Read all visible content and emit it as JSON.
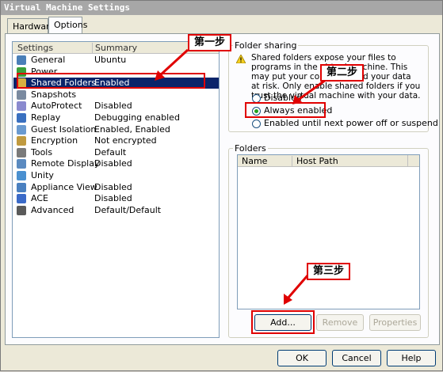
{
  "window": {
    "title": "Virtual Machine Settings"
  },
  "tabs": [
    {
      "label": "Hardware"
    },
    {
      "label": "Options"
    }
  ],
  "settings_list": {
    "col_settings": "Settings",
    "col_summary": "Summary",
    "items": [
      {
        "name": "General",
        "summary": "Ubuntu",
        "icon": "general-icon",
        "color": "#4a7fb8"
      },
      {
        "name": "Power",
        "summary": "",
        "icon": "power-icon",
        "color": "#3aa03a"
      },
      {
        "name": "Shared Folders",
        "summary": "Enabled",
        "icon": "shared-folders-icon",
        "color": "#d8b040"
      },
      {
        "name": "Snapshots",
        "summary": "",
        "icon": "snapshots-icon",
        "color": "#7a8aa0"
      },
      {
        "name": "AutoProtect",
        "summary": "Disabled",
        "icon": "autoprotect-icon",
        "color": "#8a8acf"
      },
      {
        "name": "Replay",
        "summary": "Debugging enabled",
        "icon": "replay-icon",
        "color": "#3a70c0"
      },
      {
        "name": "Guest Isolation",
        "summary": "Enabled, Enabled",
        "icon": "guest-isolation-icon",
        "color": "#6a9ad0"
      },
      {
        "name": "Encryption",
        "summary": "Not encrypted",
        "icon": "encryption-icon",
        "color": "#c09a40"
      },
      {
        "name": "Tools",
        "summary": "Default",
        "icon": "tools-icon",
        "color": "#7a7a7a"
      },
      {
        "name": "Remote Display",
        "summary": "Disabled",
        "icon": "remote-display-icon",
        "color": "#5a8ac0"
      },
      {
        "name": "Unity",
        "summary": "",
        "icon": "unity-icon",
        "color": "#4a90d0"
      },
      {
        "name": "Appliance View",
        "summary": "Disabled",
        "icon": "appliance-view-icon",
        "color": "#4a80c0"
      },
      {
        "name": "ACE",
        "summary": "Disabled",
        "icon": "ace-icon",
        "color": "#3a6ac8"
      },
      {
        "name": "Advanced",
        "summary": "Default/Default",
        "icon": "advanced-icon",
        "color": "#5a5a5a"
      }
    ]
  },
  "folder_sharing": {
    "label": "Folder sharing",
    "description": "Shared folders expose your files to programs in the virtual machine. This may put your computer and your data at risk. Only enable shared folders if you trust the virtual machine with your data.",
    "options": [
      {
        "label": "Disabled",
        "selected": false
      },
      {
        "label": "Always enabled",
        "selected": true
      },
      {
        "label": "Enabled until next power off or suspend",
        "selected": false
      }
    ]
  },
  "folders": {
    "label": "Folders",
    "col_name": "Name",
    "col_host_path": "Host Path",
    "add": "Add...",
    "remove": "Remove",
    "properties": "Properties"
  },
  "footer": {
    "ok": "OK",
    "cancel": "Cancel",
    "help": "Help"
  },
  "annotations": [
    "第一步",
    "第二步",
    "第三步"
  ],
  "colors": {
    "annotation": "#e00000",
    "selection": "#0a246a"
  }
}
